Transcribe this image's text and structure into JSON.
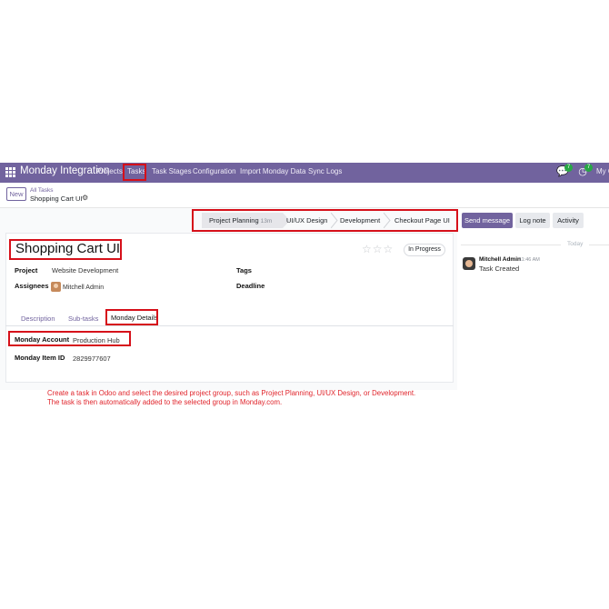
{
  "navbar": {
    "app_name": "Monday Integration",
    "menu": [
      "Projects",
      "Tasks",
      "Task Stages",
      "Configuration",
      "Import Monday Data",
      "Sync Logs"
    ],
    "messages_count": "7",
    "activities_count": "7",
    "company": "My C"
  },
  "control_panel": {
    "new_label": "New",
    "breadcrumb_parent": "All Tasks",
    "breadcrumb_current": "Shopping Cart UI"
  },
  "stages": {
    "items": [
      "Project Planning",
      "UI/UX Design",
      "Development",
      "Checkout Page UI"
    ],
    "active_duration": "13m"
  },
  "chatter": {
    "send_message": "Send message",
    "log_note": "Log note",
    "activity": "Activity",
    "date_label": "Today",
    "author": "Mitchell Admin",
    "time": "11:46 AM",
    "body": "Task Created"
  },
  "task": {
    "title": "Shopping Cart UI",
    "state": "In Progress",
    "stars": "☆☆☆",
    "fields": {
      "project_label": "Project",
      "project_value": "Website Development",
      "assignees_label": "Assignees",
      "assignees_value": "Mitchell Admin",
      "tags_label": "Tags",
      "deadline_label": "Deadline"
    }
  },
  "tabs": [
    "Description",
    "Sub-tasks",
    "Monday Details"
  ],
  "monday": {
    "account_label": "Monday Account",
    "account_value": "Production Hub",
    "item_label": "Monday Item ID",
    "item_value": "2829977607"
  },
  "caption": {
    "line1": "Create a task in Odoo and select the desired project group, such as Project Planning, UI/UX Design, or Development.",
    "line2": "The task is then automatically added to the selected group in Monday.com."
  },
  "colors": {
    "brand": "#71639e",
    "highlight": "#d6101a",
    "caption": "#e0242b"
  }
}
